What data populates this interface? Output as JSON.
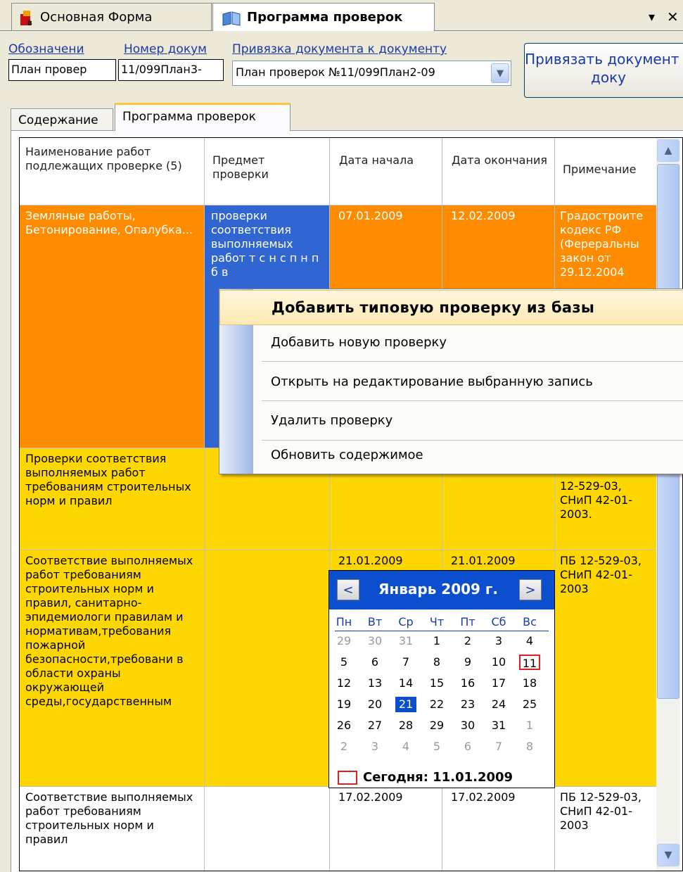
{
  "doc_tabs": [
    {
      "label": "Основная Форма",
      "active": false
    },
    {
      "label": "Программа проверок",
      "active": true
    }
  ],
  "window_controls": {
    "menu": "▾",
    "close": "✕"
  },
  "form": {
    "labels": {
      "designation": "Обозначени",
      "doc_number": "Номер докум",
      "binding": "Привязка документа к документу"
    },
    "designation_value": "План провер",
    "doc_number_value": "11/099План3-",
    "binding_value": "План проверок №11/099План2-09",
    "bind_button": "Привязать документ к доку"
  },
  "inner_tabs": [
    {
      "label": "Содержание",
      "active": false
    },
    {
      "label": "Программа проверок",
      "active": true
    }
  ],
  "grid": {
    "columns": [
      "Наименование работ подлежащих проверке (5)",
      "Предмет проверки",
      "Дата начала",
      "Дата окончания",
      "Примечание"
    ],
    "rows": [
      {
        "name": "Земляные работы, Бетонирование, Опалубка...",
        "subject": "проверки соответствия выполняемых работ т с н с п н п б в",
        "start": "07.01.2009",
        "end": "12.02.2009",
        "note": "Градостроите кодекс РФ (Фереральны закон от 29.12.2004"
      },
      {
        "name": "Проверки соответствия выполняемых работ требованиям строительных норм и правил",
        "subject": "",
        "start": "",
        "end": "",
        "note": "12-529-03, СНиП 42-01-2003."
      },
      {
        "name": "Соответствие выполняемых работ требованиям строительных норм и правил, санитарно-эпидемиологи правилам и нормативам,требования пожарной безопасности,требовани в области охраны окружающей среды,государственным",
        "subject": "",
        "start": "21.01.2009",
        "end": "21.01.2009",
        "note": "ПБ 12-529-03, СНиП 42-01-2003"
      },
      {
        "name": "Соответствие выполняемых работ требованиям строительных норм и правил",
        "subject": "",
        "start": "17.02.2009",
        "end": "17.02.2009",
        "note": "ПБ 12-529-03, СНиП 42-01-2003"
      }
    ]
  },
  "context_menu": {
    "items": [
      "Добавить типовую проверку из базы",
      "Добавить новую проверку",
      "Открыть на редактирование выбранную запись",
      "Удалить проверку",
      "Обновить содержимое"
    ]
  },
  "calendar": {
    "title": "Январь 2009 г.",
    "prev": "<",
    "next": ">",
    "weekdays": [
      "Пн",
      "Вт",
      "Ср",
      "Чт",
      "Пт",
      "Сб",
      "Вс"
    ],
    "weeks": [
      [
        "29",
        "30",
        "31",
        "1",
        "2",
        "3",
        "4"
      ],
      [
        "5",
        "6",
        "7",
        "8",
        "9",
        "10",
        "11"
      ],
      [
        "12",
        "13",
        "14",
        "15",
        "16",
        "17",
        "18"
      ],
      [
        "19",
        "20",
        "21",
        "22",
        "23",
        "24",
        "25"
      ],
      [
        "26",
        "27",
        "28",
        "29",
        "30",
        "31",
        "1"
      ],
      [
        "2",
        "3",
        "4",
        "5",
        "6",
        "7",
        "8"
      ]
    ],
    "selected_day": "21",
    "today_day": "11",
    "today_label": "Сегодня: 11.01.2009"
  },
  "colors": {
    "row_selected": "#ff8c00",
    "row_highlight": "#ffd700",
    "cell_selected": "#3165d1",
    "calendar_header": "#0b4fcf",
    "today_marker": "#e02020"
  },
  "icons": {
    "doc_tab_0": "app-icon",
    "doc_tab_1": "book-icon",
    "combo": "chevron-down-icon",
    "scroll_up": "chevron-up-icon",
    "scroll_down": "chevron-down-icon",
    "cal_prev": "chevron-left-icon",
    "cal_next": "chevron-right-icon"
  }
}
